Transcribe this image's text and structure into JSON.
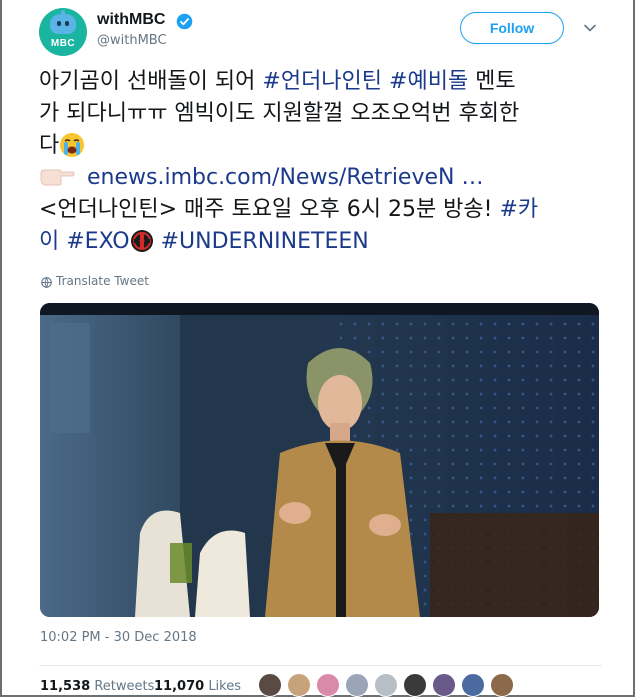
{
  "account": {
    "display_name": "withMBC",
    "handle": "@withMBC",
    "avatar_logo_text": "MBC",
    "verified": true
  },
  "follow_label": "Follow",
  "tweet": {
    "line1_text": "아기곰이 선배돌이 되어 ",
    "line1_hashtag1": "#언더나인틴",
    "line1_hashtag2": "#예비돌",
    "line1_tail": " 멘토",
    "line2_text": "가 되다니ㅠㅠ 엠빅이도 지원할껄 오조오억번 후회한",
    "line3_text": "다",
    "link_text": "enews.imbc.com/News/RetrieveN …",
    "line5_text": "<언더나인틴> 매주 토요일 오후 6시 25분 방송! ",
    "line5_hashtag": "#카",
    "line6_hashtag_part": "이",
    "line6_hashtag_exo": "#EXO",
    "line6_hashtag_under": "#UNDERNINETEEN",
    "emoji_names": [
      "loudly-crying-face-icon",
      "pointing-right-icon",
      "exo-logo-icon"
    ]
  },
  "translate_label": "Translate Tweet",
  "timestamp": "10:02 PM - 30 Dec 2018",
  "stats": {
    "retweets_count": "11,538",
    "retweets_label": "Retweets",
    "likes_count": "11,070",
    "likes_label": "Likes"
  },
  "likers_count": 9,
  "colors": {
    "hashtag": "#1b3a8c",
    "follow_blue": "#1da1f2",
    "secondary_text": "#657786",
    "avatar_bg": "#1ab5a0"
  }
}
